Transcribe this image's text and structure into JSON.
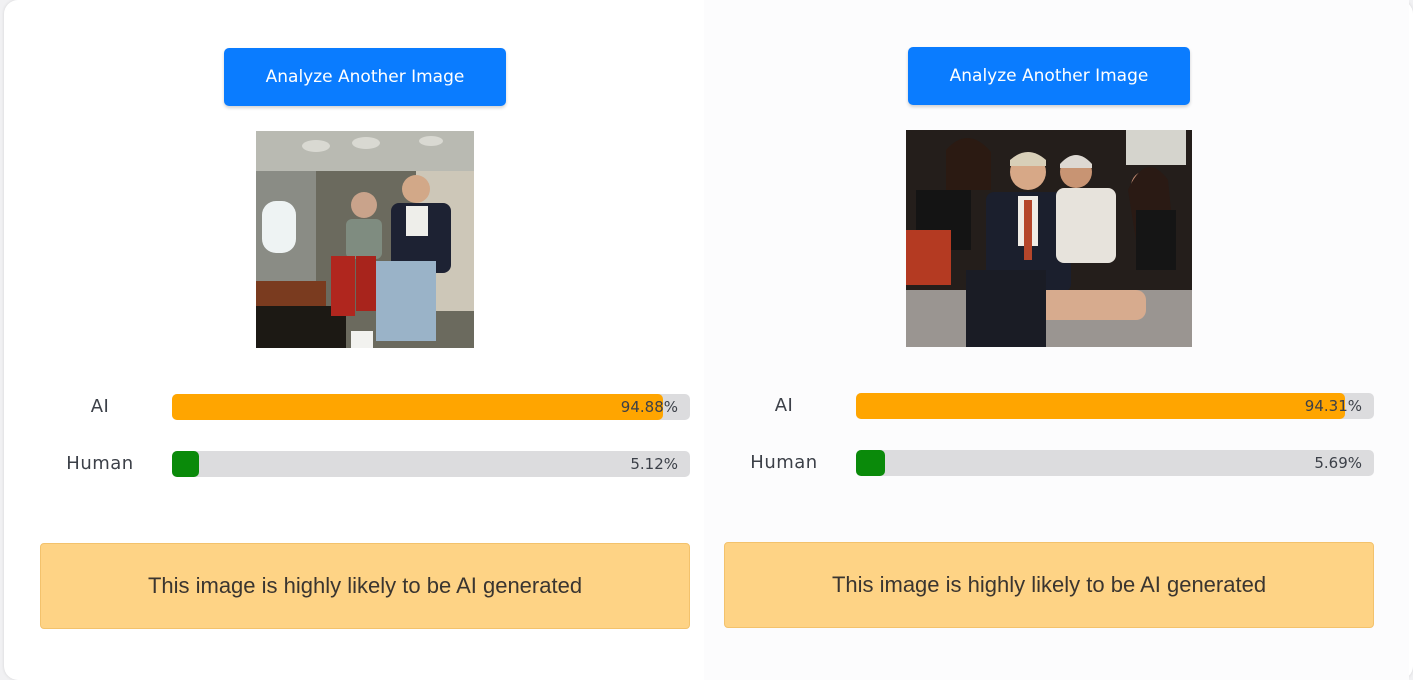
{
  "panels": [
    {
      "button_label": "Analyze Another Image",
      "image_alt": "Photo of two men seated in a private jet cabin",
      "scores": [
        {
          "label": "AI",
          "percent_text": "94.88%",
          "value": 94.88,
          "color": "#ffa500"
        },
        {
          "label": "Human",
          "percent_text": "5.12%",
          "value": 5.12,
          "color": "#0a8a0a"
        }
      ],
      "verdict": "This image is highly likely to be AI generated"
    },
    {
      "button_label": "Analyze Another Image",
      "image_alt": "Photo of a group of people posing closely on a couch",
      "scores": [
        {
          "label": "AI",
          "percent_text": "94.31%",
          "value": 94.31,
          "color": "#ffa500"
        },
        {
          "label": "Human",
          "percent_text": "5.69%",
          "value": 5.69,
          "color": "#0a8a0a"
        }
      ],
      "verdict": "This image is highly likely to be AI generated"
    }
  ],
  "colors": {
    "button": "#0a7cff",
    "ai_bar": "#ffa500",
    "human_bar": "#0a8a0a",
    "verdict_bg": "#fed385"
  }
}
